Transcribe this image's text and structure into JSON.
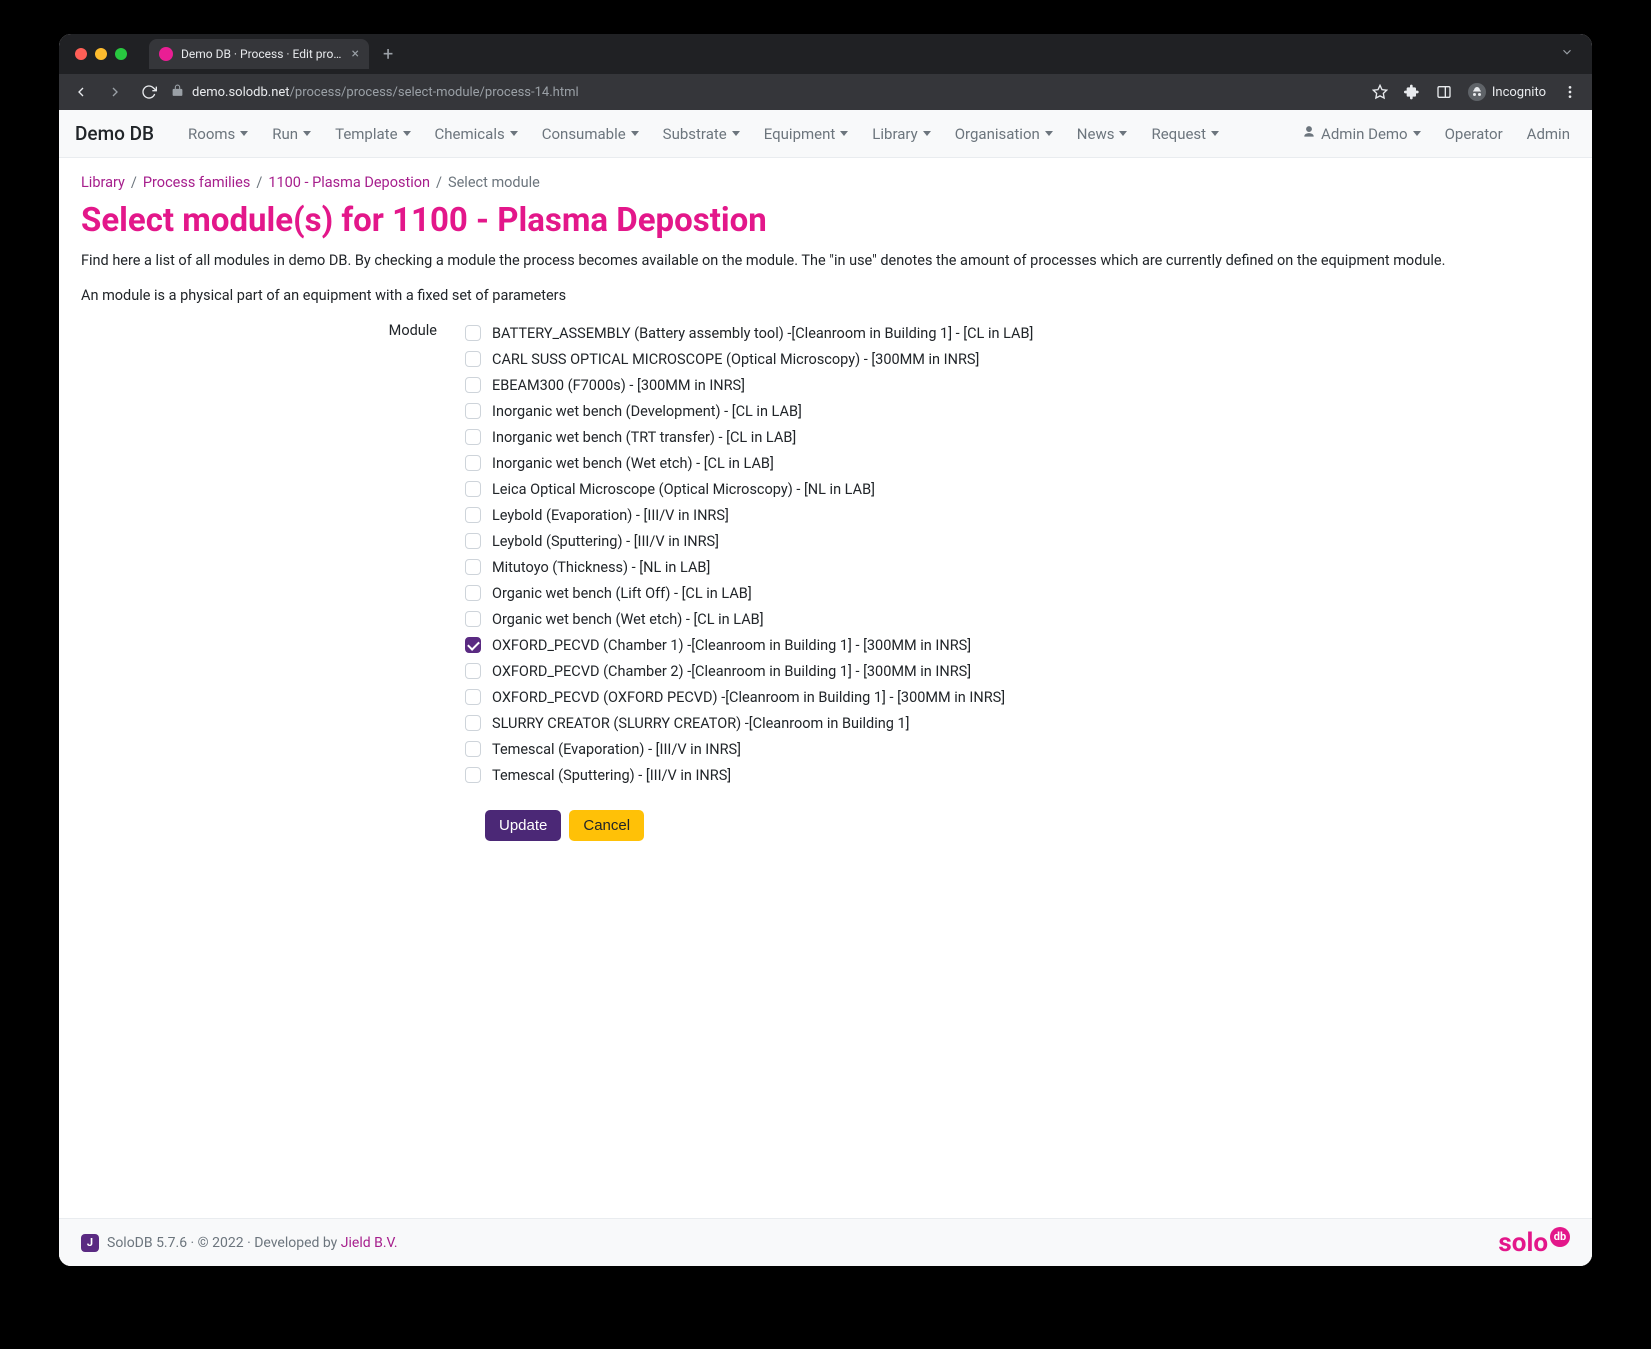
{
  "browser": {
    "tab_title": "Demo DB · Process · Edit proce",
    "url_host": "demo.solodb.net",
    "url_path": "/process/process/select-module/process-14.html",
    "incognito_label": "Incognito"
  },
  "nav": {
    "brand": "Demo DB",
    "items": [
      "Rooms",
      "Run",
      "Template",
      "Chemicals",
      "Consumable",
      "Substrate",
      "Equipment",
      "Library",
      "Organisation",
      "News",
      "Request"
    ],
    "user_label": "Admin Demo",
    "right_links": [
      "Operator",
      "Admin"
    ]
  },
  "breadcrumb": {
    "items": [
      {
        "label": "Library",
        "link": true
      },
      {
        "label": "Process families",
        "link": true
      },
      {
        "label": "1100 - Plasma Depostion",
        "link": true
      },
      {
        "label": "Select module",
        "link": false
      }
    ]
  },
  "page": {
    "title": "Select module(s) for 1100 - Plasma Depostion",
    "desc1": "Find here a list of all modules in demo DB. By checking a module the process becomes available on the module. The \"in use\" denotes the amount of processes which are currently defined on the equipment module.",
    "desc2": "An module is a physical part of an equipment with a fixed set of parameters",
    "form_label": "Module"
  },
  "modules": [
    {
      "label": "BATTERY_ASSEMBLY (Battery assembly tool) -[Cleanroom in Building 1] - [CL in LAB]",
      "checked": false
    },
    {
      "label": "CARL SUSS OPTICAL MICROSCOPE (Optical Microscopy) - [300MM in INRS]",
      "checked": false
    },
    {
      "label": "EBEAM300 (F7000s) - [300MM in INRS]",
      "checked": false
    },
    {
      "label": "Inorganic wet bench (Development) - [CL in LAB]",
      "checked": false
    },
    {
      "label": "Inorganic wet bench (TRT transfer) - [CL in LAB]",
      "checked": false
    },
    {
      "label": "Inorganic wet bench (Wet etch) - [CL in LAB]",
      "checked": false
    },
    {
      "label": "Leica Optical Microscope (Optical Microscopy) - [NL in LAB]",
      "checked": false
    },
    {
      "label": "Leybold (Evaporation) - [III/V in INRS]",
      "checked": false
    },
    {
      "label": "Leybold (Sputtering) - [III/V in INRS]",
      "checked": false
    },
    {
      "label": "Mitutoyo (Thickness) - [NL in LAB]",
      "checked": false
    },
    {
      "label": "Organic wet bench (Lift Off) - [CL in LAB]",
      "checked": false
    },
    {
      "label": "Organic wet bench (Wet etch) - [CL in LAB]",
      "checked": false
    },
    {
      "label": "OXFORD_PECVD (Chamber 1) -[Cleanroom in Building 1] - [300MM in INRS]",
      "checked": true
    },
    {
      "label": "OXFORD_PECVD (Chamber 2) -[Cleanroom in Building 1] - [300MM in INRS]",
      "checked": false
    },
    {
      "label": "OXFORD_PECVD (OXFORD PECVD) -[Cleanroom in Building 1] - [300MM in INRS]",
      "checked": false
    },
    {
      "label": "SLURRY CREATOR (SLURRY CREATOR) -[Cleanroom in Building 1]",
      "checked": false
    },
    {
      "label": "Temescal (Evaporation) - [III/V in INRS]",
      "checked": false
    },
    {
      "label": "Temescal (Sputtering) - [III/V in INRS]",
      "checked": false
    }
  ],
  "actions": {
    "update": "Update",
    "cancel": "Cancel"
  },
  "footer": {
    "text_prefix": "SoloDB 5.7.6 · © 2022 · Developed by ",
    "developer": "Jield B.V.",
    "logo_text": "solo",
    "logo_badge": "db"
  }
}
